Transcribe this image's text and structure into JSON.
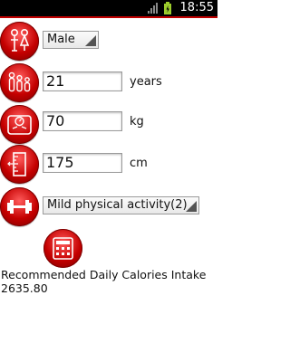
{
  "status_bar": {
    "time": "18:55"
  },
  "gender": {
    "value": "Male",
    "icon": "gender-icon"
  },
  "age": {
    "value": "21",
    "unit": "years",
    "icon": "age-icon"
  },
  "weight": {
    "value": "70",
    "unit": "kg",
    "icon": "scale-icon"
  },
  "height": {
    "value": "175",
    "unit": "cm",
    "icon": "ruler-icon"
  },
  "activity": {
    "value": "Mild physical activity(2)",
    "icon": "dumbbell-icon"
  },
  "calculate": {
    "icon": "calculator-icon"
  },
  "result": {
    "label": "Recommended Daily Calories Intake",
    "value": "2635.80"
  },
  "colors": {
    "accent": "#c40000",
    "status_bar": "#000000"
  }
}
